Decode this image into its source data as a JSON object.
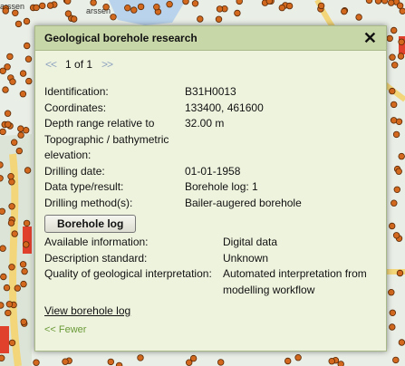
{
  "map": {
    "place_label_1": "arssen",
    "place_label_2": "arssen"
  },
  "popup": {
    "title": "Geological borehole research",
    "close_icon": "close-icon",
    "pager": {
      "prev": "<<",
      "count": "1 of 1",
      "next": ">>"
    },
    "fields": [
      {
        "label": "Identification:",
        "value": "B31H0013"
      },
      {
        "label": "Coordinates:",
        "value": "133400, 461600"
      },
      {
        "label": "Depth range relative to Topographic / bathymetric elevation:",
        "value": "32.00 m"
      },
      {
        "label": "Drilling date:",
        "value": "01-01-1958"
      },
      {
        "label": "Data type/result:",
        "value": "Borehole log: 1"
      },
      {
        "label": "Drilling method(s):",
        "value": "Bailer-augered borehole"
      }
    ],
    "borehole_log_button": "Borehole log",
    "info_fields": [
      {
        "label": "Available information:",
        "value": "Digital data"
      },
      {
        "label": "Description standard:",
        "value": "Unknown"
      },
      {
        "label": "Quality of geological interpretation:",
        "value": "Automated interpretation from modelling workflow"
      }
    ],
    "view_log_link": "View borehole log",
    "fewer_link": "<< Fewer"
  },
  "colors": {
    "dot": "#d2691e",
    "road": "#f3d67a",
    "water": "#b9d3ec",
    "header": "#c8d7a7"
  }
}
